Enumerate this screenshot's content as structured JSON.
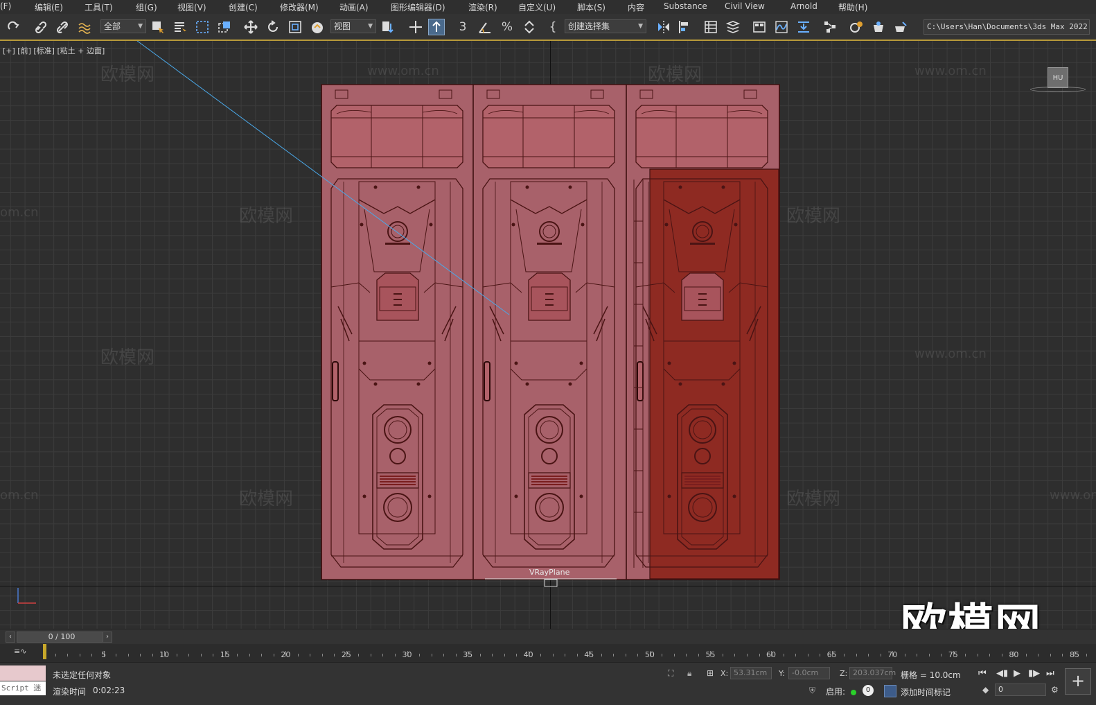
{
  "menu": [
    "(F)",
    "编辑(E)",
    "工具(T)",
    "组(G)",
    "视图(V)",
    "创建(C)",
    "修改器(M)",
    "动画(A)",
    "图形编辑器(D)",
    "渲染(R)",
    "自定义(U)",
    "脚本(S)",
    "内容",
    "Substance",
    "Civil View",
    "Arnold",
    "帮助(H)"
  ],
  "toolbar": {
    "selection_filter": "全部",
    "reference_coord": "视图",
    "named_selection": "创建选择集",
    "project_path": "C:\\Users\\Han\\Documents\\3ds Max 2022"
  },
  "viewport": {
    "label": "[+] [前] [标准] [粘土 + 边面]",
    "object_name": "VRayPlane",
    "viewcube_text": "HU",
    "watermark_cn": "欧模网",
    "watermark_url": "www.om.cn",
    "watermark_url_partial": "om.cn",
    "brand_logo": "欧模网",
    "accent_color": "#a04838"
  },
  "timeline": {
    "frame_display": "0 / 100",
    "ticks": [
      "5",
      "10",
      "15",
      "20",
      "25",
      "30",
      "35",
      "40",
      "45",
      "50",
      "55",
      "60",
      "65",
      "70",
      "75",
      "80",
      "85"
    ]
  },
  "status": {
    "script_label": "Script 迷",
    "selection_msg": "未选定任何对象",
    "render_time_label": "渲染时间",
    "render_time_value": "0:02:23",
    "x_label": "X:",
    "x_value": "53.31cm",
    "y_label": "Y:",
    "y_value": "-0.0cm",
    "z_label": "Z:",
    "z_value": "203.037cm",
    "grid_label": "栅格 = 10.0cm",
    "enable_label": "启用:",
    "enable_count": "0",
    "add_time_tag": "添加时间标记",
    "frame_field": "0"
  }
}
